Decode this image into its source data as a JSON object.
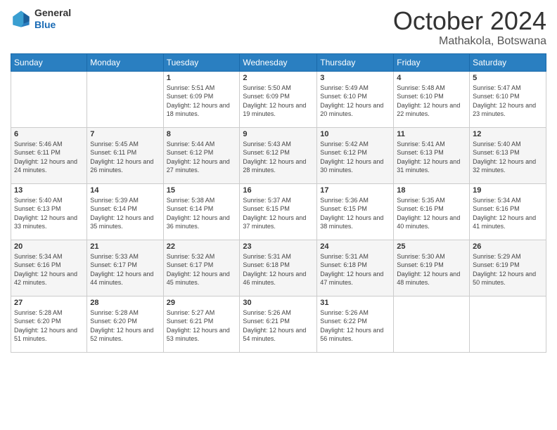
{
  "logo": {
    "general": "General",
    "blue": "Blue"
  },
  "header": {
    "month": "October 2024",
    "location": "Mathakola, Botswana"
  },
  "weekdays": [
    "Sunday",
    "Monday",
    "Tuesday",
    "Wednesday",
    "Thursday",
    "Friday",
    "Saturday"
  ],
  "weeks": [
    [
      {
        "day": "",
        "info": ""
      },
      {
        "day": "",
        "info": ""
      },
      {
        "day": "1",
        "info": "Sunrise: 5:51 AM\nSunset: 6:09 PM\nDaylight: 12 hours and 18 minutes."
      },
      {
        "day": "2",
        "info": "Sunrise: 5:50 AM\nSunset: 6:09 PM\nDaylight: 12 hours and 19 minutes."
      },
      {
        "day": "3",
        "info": "Sunrise: 5:49 AM\nSunset: 6:10 PM\nDaylight: 12 hours and 20 minutes."
      },
      {
        "day": "4",
        "info": "Sunrise: 5:48 AM\nSunset: 6:10 PM\nDaylight: 12 hours and 22 minutes."
      },
      {
        "day": "5",
        "info": "Sunrise: 5:47 AM\nSunset: 6:10 PM\nDaylight: 12 hours and 23 minutes."
      }
    ],
    [
      {
        "day": "6",
        "info": "Sunrise: 5:46 AM\nSunset: 6:11 PM\nDaylight: 12 hours and 24 minutes."
      },
      {
        "day": "7",
        "info": "Sunrise: 5:45 AM\nSunset: 6:11 PM\nDaylight: 12 hours and 26 minutes."
      },
      {
        "day": "8",
        "info": "Sunrise: 5:44 AM\nSunset: 6:12 PM\nDaylight: 12 hours and 27 minutes."
      },
      {
        "day": "9",
        "info": "Sunrise: 5:43 AM\nSunset: 6:12 PM\nDaylight: 12 hours and 28 minutes."
      },
      {
        "day": "10",
        "info": "Sunrise: 5:42 AM\nSunset: 6:12 PM\nDaylight: 12 hours and 30 minutes."
      },
      {
        "day": "11",
        "info": "Sunrise: 5:41 AM\nSunset: 6:13 PM\nDaylight: 12 hours and 31 minutes."
      },
      {
        "day": "12",
        "info": "Sunrise: 5:40 AM\nSunset: 6:13 PM\nDaylight: 12 hours and 32 minutes."
      }
    ],
    [
      {
        "day": "13",
        "info": "Sunrise: 5:40 AM\nSunset: 6:13 PM\nDaylight: 12 hours and 33 minutes."
      },
      {
        "day": "14",
        "info": "Sunrise: 5:39 AM\nSunset: 6:14 PM\nDaylight: 12 hours and 35 minutes."
      },
      {
        "day": "15",
        "info": "Sunrise: 5:38 AM\nSunset: 6:14 PM\nDaylight: 12 hours and 36 minutes."
      },
      {
        "day": "16",
        "info": "Sunrise: 5:37 AM\nSunset: 6:15 PM\nDaylight: 12 hours and 37 minutes."
      },
      {
        "day": "17",
        "info": "Sunrise: 5:36 AM\nSunset: 6:15 PM\nDaylight: 12 hours and 38 minutes."
      },
      {
        "day": "18",
        "info": "Sunrise: 5:35 AM\nSunset: 6:16 PM\nDaylight: 12 hours and 40 minutes."
      },
      {
        "day": "19",
        "info": "Sunrise: 5:34 AM\nSunset: 6:16 PM\nDaylight: 12 hours and 41 minutes."
      }
    ],
    [
      {
        "day": "20",
        "info": "Sunrise: 5:34 AM\nSunset: 6:16 PM\nDaylight: 12 hours and 42 minutes."
      },
      {
        "day": "21",
        "info": "Sunrise: 5:33 AM\nSunset: 6:17 PM\nDaylight: 12 hours and 44 minutes."
      },
      {
        "day": "22",
        "info": "Sunrise: 5:32 AM\nSunset: 6:17 PM\nDaylight: 12 hours and 45 minutes."
      },
      {
        "day": "23",
        "info": "Sunrise: 5:31 AM\nSunset: 6:18 PM\nDaylight: 12 hours and 46 minutes."
      },
      {
        "day": "24",
        "info": "Sunrise: 5:31 AM\nSunset: 6:18 PM\nDaylight: 12 hours and 47 minutes."
      },
      {
        "day": "25",
        "info": "Sunrise: 5:30 AM\nSunset: 6:19 PM\nDaylight: 12 hours and 48 minutes."
      },
      {
        "day": "26",
        "info": "Sunrise: 5:29 AM\nSunset: 6:19 PM\nDaylight: 12 hours and 50 minutes."
      }
    ],
    [
      {
        "day": "27",
        "info": "Sunrise: 5:28 AM\nSunset: 6:20 PM\nDaylight: 12 hours and 51 minutes."
      },
      {
        "day": "28",
        "info": "Sunrise: 5:28 AM\nSunset: 6:20 PM\nDaylight: 12 hours and 52 minutes."
      },
      {
        "day": "29",
        "info": "Sunrise: 5:27 AM\nSunset: 6:21 PM\nDaylight: 12 hours and 53 minutes."
      },
      {
        "day": "30",
        "info": "Sunrise: 5:26 AM\nSunset: 6:21 PM\nDaylight: 12 hours and 54 minutes."
      },
      {
        "day": "31",
        "info": "Sunrise: 5:26 AM\nSunset: 6:22 PM\nDaylight: 12 hours and 56 minutes."
      },
      {
        "day": "",
        "info": ""
      },
      {
        "day": "",
        "info": ""
      }
    ]
  ]
}
